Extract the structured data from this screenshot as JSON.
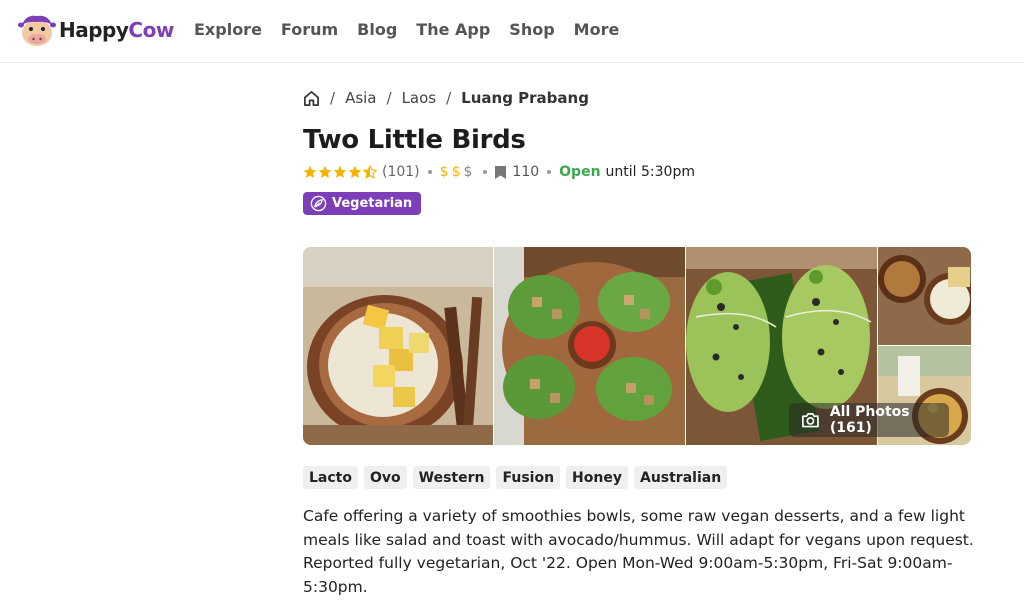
{
  "brand": {
    "happy": "Happy",
    "cow": "Cow",
    "accent": "#7c3fb8"
  },
  "nav": {
    "items": [
      "Explore",
      "Forum",
      "Blog",
      "The App",
      "Shop",
      "More"
    ]
  },
  "breadcrumb": {
    "items": [
      "Asia",
      "Laos",
      "Luang Prabang"
    ]
  },
  "listing": {
    "name": "Two Little Birds",
    "rating": 4.5,
    "review_count": "(101)",
    "price_symbols": [
      "$",
      "$",
      "$"
    ],
    "price_level": 2,
    "bookmarks": "110",
    "open_status": "Open",
    "open_until": "until 5:30pm",
    "badge": "Vegetarian",
    "all_photos": "All Photos (161)",
    "tags": [
      "Lacto",
      "Ovo",
      "Western",
      "Fusion",
      "Honey",
      "Australian"
    ],
    "description": "Cafe offering a variety of smoothies bowls, some raw vegan desserts, and a few light meals like salad and toast with avocado/hummus. Will adapt for vegans upon request. Reported fully vegetarian, Oct '22. Open Mon-Wed 9:00am-5:30pm, Fri-Sat 9:00am-5:30pm."
  },
  "colors": {
    "star": "#f4b400",
    "open": "#3aa84d",
    "tag_bg": "#efefef"
  }
}
